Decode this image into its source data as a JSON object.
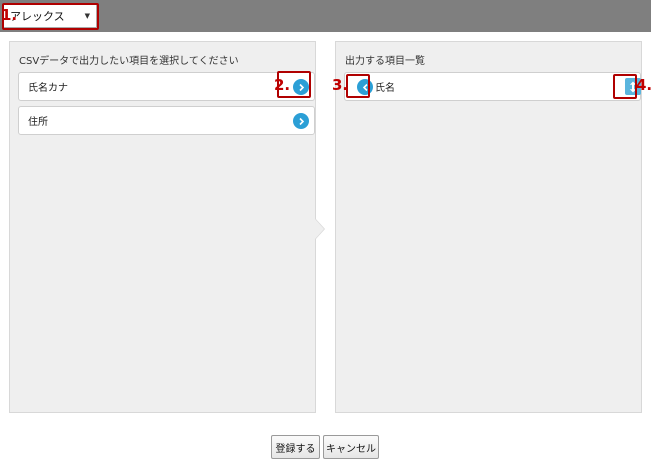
{
  "header": {
    "select_value": "アレックス"
  },
  "left_panel": {
    "title": "CSVデータで出力したい項目を選択してください",
    "items": [
      {
        "label": "氏名カナ"
      },
      {
        "label": "住所"
      }
    ]
  },
  "right_panel": {
    "title": "出力する項目一覧",
    "items": [
      {
        "label": "氏名"
      }
    ]
  },
  "annotations": {
    "one": "1.",
    "two": "2.",
    "three": "3.",
    "four": "4."
  },
  "footer": {
    "register_label": "登録する",
    "cancel_label": "キャンセル"
  },
  "colors": {
    "accent": "#2b9fd6",
    "highlight": "#b00000",
    "topbar": "#7f7f7f"
  }
}
